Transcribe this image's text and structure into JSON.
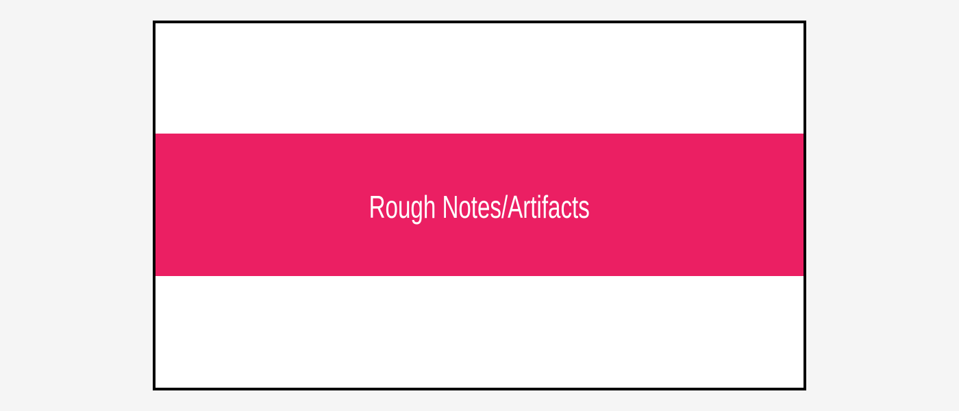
{
  "slide": {
    "title": "Rough Notes/Artifacts",
    "colors": {
      "page_background": "#f5f5f5",
      "slide_background": "#ffffff",
      "border": "#000000",
      "band": "#eb1f63",
      "title_text": "#ffffff"
    }
  }
}
